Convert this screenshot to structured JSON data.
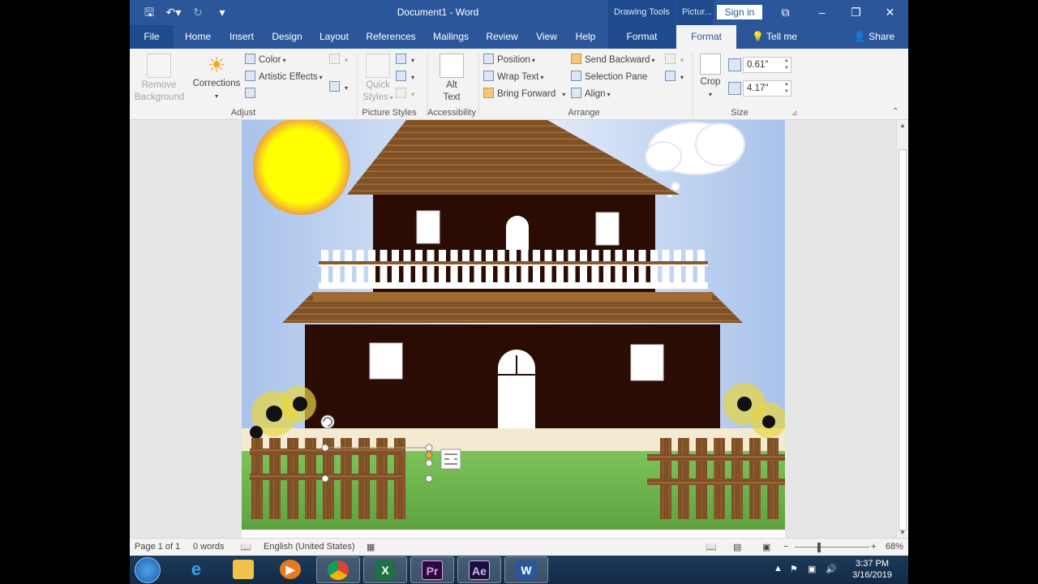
{
  "window": {
    "doc_title": "Document1  -  Word",
    "ctx_drawing": "Drawing Tools",
    "ctx_picture": "Pictur...",
    "signin": "Sign in"
  },
  "tabs": {
    "file": "File",
    "home": "Home",
    "insert": "Insert",
    "design": "Design",
    "layout": "Layout",
    "references": "References",
    "mailings": "Mailings",
    "review": "Review",
    "view": "View",
    "help": "Help",
    "format1": "Format",
    "format2": "Format",
    "tellme": "Tell me",
    "share": "Share"
  },
  "ribbon": {
    "remove_bg_1": "Remove",
    "remove_bg_2": "Background",
    "corrections": "Corrections",
    "color": "Color",
    "artistic": "Artistic Effects",
    "adjust": "Adjust",
    "quick_1": "Quick",
    "quick_2": "Styles",
    "picture_styles": "Picture Styles",
    "alt_1": "Alt",
    "alt_2": "Text",
    "accessibility": "Accessibility",
    "position": "Position",
    "wrap": "Wrap Text",
    "bring": "Bring Forward",
    "send": "Send Backward",
    "selection": "Selection Pane",
    "align": "Align",
    "arrange": "Arrange",
    "crop": "Crop",
    "height": "0.61\"",
    "width": "4.17\"",
    "size": "Size"
  },
  "status": {
    "page": "Page 1 of 1",
    "words": "0 words",
    "lang": "English (United States)",
    "zoom": "68%"
  },
  "taskbar": {
    "excel": "X",
    "premiere": "Pr",
    "aftereffects": "Ae",
    "word": "W",
    "time": "3:37 PM",
    "date": "3/16/2019"
  },
  "colors": {
    "word_blue": "#2b579a",
    "house_wall": "#2a0c05",
    "roof": "#8a5a2e",
    "sun": "#ffff00",
    "grass": "#6bb54a"
  }
}
